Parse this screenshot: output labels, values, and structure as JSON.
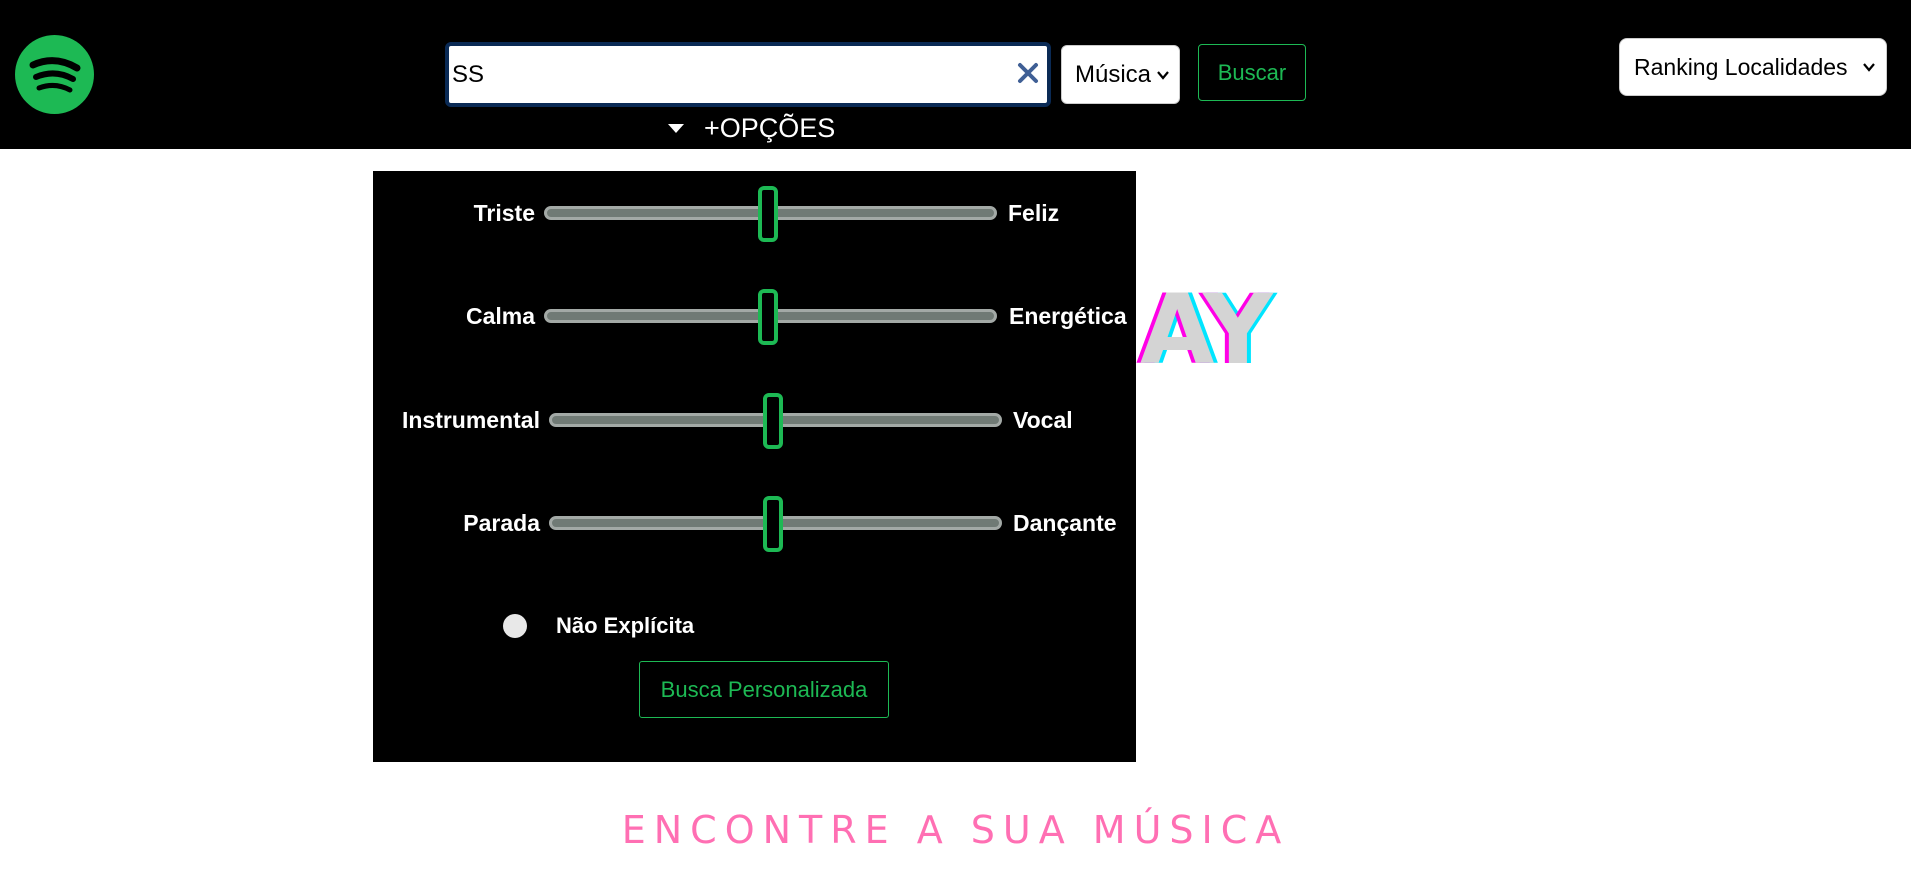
{
  "colors": {
    "brand": "#1DB954",
    "header_bg": "#000000",
    "panel_bg": "#000000",
    "tagline": "#ff6fb3"
  },
  "header": {
    "logo_icon": "spotify-logo-icon",
    "search": {
      "value": "SS",
      "placeholder": ""
    },
    "type_select": {
      "selected": "Música"
    },
    "search_button": "Buscar",
    "ranking_select": {
      "selected": "Ranking Localidades"
    },
    "options_toggle": "+OPÇÕES"
  },
  "options_panel": {
    "sliders": [
      {
        "left": "Triste",
        "right": "Feliz",
        "value": 0.5
      },
      {
        "left": "Calma",
        "right": "Energética",
        "value": 0.5
      },
      {
        "left": "Instrumental",
        "right": "Vocal",
        "value": 0.5
      },
      {
        "left": "Parada",
        "right": "Dançante",
        "value": 0.5
      }
    ],
    "explicit_toggle_label": "Não Explícita",
    "custom_search_button": "Busca Personalizada"
  },
  "hero": {
    "title_visible": "AY",
    "tagline": "ENCONTRE A SUA MÚSICA"
  }
}
